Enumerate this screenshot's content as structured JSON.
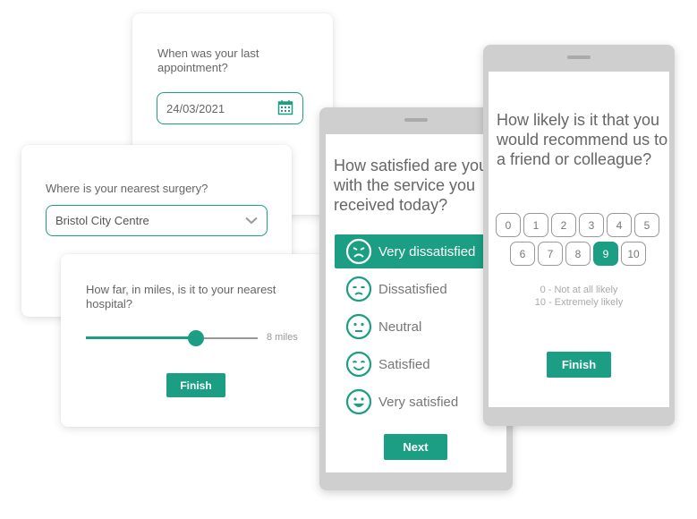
{
  "colors": {
    "accent": "#1b9e83",
    "phone_frame": "#cfcfcf",
    "text": "#666666"
  },
  "date_card": {
    "question": "When was your last appointment?",
    "date_value": "24/03/2021",
    "icon": "calendar-icon"
  },
  "select_card": {
    "question": "Where is your nearest surgery?",
    "selected_value": "Bristol City Centre",
    "icon": "chevron-down-icon"
  },
  "slider_card": {
    "question": "How far, in miles, is it to your nearest hospital?",
    "slider_fraction": 0.64,
    "value_label": "8 miles",
    "finish_label": "Finish"
  },
  "satisfaction_phone": {
    "question": "How satisfied are you with the service you received today?",
    "options": [
      {
        "label": "Very dissatisfied",
        "icon": "very-dissatisfied-face-icon",
        "selected": true
      },
      {
        "label": "Dissatisfied",
        "icon": "dissatisfied-face-icon",
        "selected": false
      },
      {
        "label": "Neutral",
        "icon": "neutral-face-icon",
        "selected": false
      },
      {
        "label": "Satisfied",
        "icon": "satisfied-face-icon",
        "selected": false
      },
      {
        "label": "Very satisfied",
        "icon": "very-satisfied-face-icon",
        "selected": false
      }
    ],
    "next_label": "Next"
  },
  "nps_phone": {
    "question": "How likely is it that you would recommend us to a friend or colleague?",
    "scale": [
      "0",
      "1",
      "2",
      "3",
      "4",
      "5",
      "6",
      "7",
      "8",
      "9",
      "10"
    ],
    "selected": "9",
    "legend_low": "0 - Not at all likely",
    "legend_high": "10 - Extremely likely",
    "finish_label": "Finish"
  }
}
